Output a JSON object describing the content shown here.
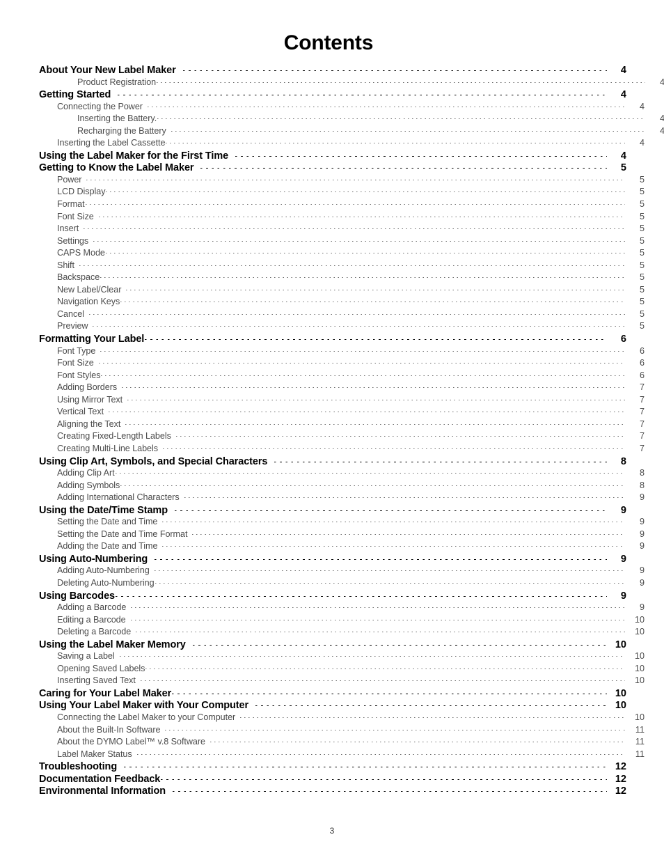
{
  "document": {
    "title": "Contents",
    "footer_page_number": "3"
  },
  "colors": {
    "heading_text": "#000000",
    "entry_text": "#4b4b4b",
    "leader_bold": "#000000",
    "leader_regular": "#6e6e6e",
    "background": "#ffffff"
  },
  "toc": {
    "entries": [
      {
        "label": "About Your New Label Maker",
        "page": "4",
        "level": 0,
        "tight": false
      },
      {
        "label": "Product Registration",
        "page": "4",
        "level": 2,
        "tight": true
      },
      {
        "label": "Getting Started",
        "page": "4",
        "level": 0,
        "tight": false
      },
      {
        "label": "Connecting the Power",
        "page": "4",
        "level": 1,
        "tight": false
      },
      {
        "label": "Inserting the Battery.",
        "page": "4",
        "level": 2,
        "tight": true
      },
      {
        "label": "Recharging the Battery",
        "page": "4",
        "level": 2,
        "tight": false
      },
      {
        "label": "Inserting the Label Cassette",
        "page": "4",
        "level": 1,
        "tight": true
      },
      {
        "label": "Using the Label Maker for the First Time",
        "page": "4",
        "level": 0,
        "tight": false
      },
      {
        "label": "Getting to Know the Label Maker",
        "page": "5",
        "level": 0,
        "tight": false
      },
      {
        "label": "Power",
        "page": "5",
        "level": 1,
        "tight": false
      },
      {
        "label": "LCD Display",
        "page": "5",
        "level": 1,
        "tight": true
      },
      {
        "label": "Format",
        "page": "5",
        "level": 1,
        "tight": true
      },
      {
        "label": "Font Size",
        "page": "5",
        "level": 1,
        "tight": false
      },
      {
        "label": "Insert",
        "page": "5",
        "level": 1,
        "tight": false
      },
      {
        "label": "Settings",
        "page": "5",
        "level": 1,
        "tight": false
      },
      {
        "label": "CAPS Mode",
        "page": "5",
        "level": 1,
        "tight": true
      },
      {
        "label": "Shift",
        "page": "5",
        "level": 1,
        "tight": false
      },
      {
        "label": "Backspace",
        "page": "5",
        "level": 1,
        "tight": true
      },
      {
        "label": "New Label/Clear",
        "page": "5",
        "level": 1,
        "tight": false
      },
      {
        "label": "Navigation Keys",
        "page": "5",
        "level": 1,
        "tight": true
      },
      {
        "label": "Cancel",
        "page": "5",
        "level": 1,
        "tight": false
      },
      {
        "label": "Preview",
        "page": "5",
        "level": 1,
        "tight": false
      },
      {
        "label": "Formatting Your Label",
        "page": "6",
        "level": 0,
        "tight": true
      },
      {
        "label": "Font Type",
        "page": "6",
        "level": 1,
        "tight": false
      },
      {
        "label": "Font Size",
        "page": "6",
        "level": 1,
        "tight": false
      },
      {
        "label": "Font Styles",
        "page": "6",
        "level": 1,
        "tight": true
      },
      {
        "label": "Adding Borders",
        "page": "7",
        "level": 1,
        "tight": false
      },
      {
        "label": "Using Mirror Text",
        "page": "7",
        "level": 1,
        "tight": false
      },
      {
        "label": "Vertical Text",
        "page": "7",
        "level": 1,
        "tight": false
      },
      {
        "label": "Aligning the Text",
        "page": "7",
        "level": 1,
        "tight": false
      },
      {
        "label": "Creating Fixed-Length Labels",
        "page": "7",
        "level": 1,
        "tight": false
      },
      {
        "label": "Creating Multi-Line Labels",
        "page": "7",
        "level": 1,
        "tight": false
      },
      {
        "label": "Using Clip Art, Symbols, and Special Characters",
        "page": "8",
        "level": 0,
        "tight": false
      },
      {
        "label": "Adding Clip Art",
        "page": "8",
        "level": 1,
        "tight": true
      },
      {
        "label": "Adding Symbols",
        "page": "8",
        "level": 1,
        "tight": true
      },
      {
        "label": "Adding International Characters",
        "page": "9",
        "level": 1,
        "tight": false
      },
      {
        "label": "Using the Date/Time Stamp",
        "page": "9",
        "level": 0,
        "tight": false
      },
      {
        "label": "Setting the Date and Time",
        "page": "9",
        "level": 1,
        "tight": false
      },
      {
        "label": "Setting the Date and Time Format",
        "page": "9",
        "level": 1,
        "tight": false
      },
      {
        "label": "Adding the Date and Time",
        "page": "9",
        "level": 1,
        "tight": false
      },
      {
        "label": "Using Auto-Numbering",
        "page": "9",
        "level": 0,
        "tight": false
      },
      {
        "label": "Adding Auto-Numbering",
        "page": "9",
        "level": 1,
        "tight": false
      },
      {
        "label": "Deleting Auto-Numbering",
        "page": "9",
        "level": 1,
        "tight": true
      },
      {
        "label": "Using Barcodes",
        "page": "9",
        "level": 0,
        "tight": true
      },
      {
        "label": "Adding a Barcode",
        "page": "9",
        "level": 1,
        "tight": false
      },
      {
        "label": "Editing a Barcode",
        "page": "10",
        "level": 1,
        "tight": false
      },
      {
        "label": "Deleting a Barcode",
        "page": "10",
        "level": 1,
        "tight": false
      },
      {
        "label": "Using the Label Maker Memory",
        "page": "10",
        "level": 0,
        "tight": false
      },
      {
        "label": "Saving a Label",
        "page": "10",
        "level": 1,
        "tight": false
      },
      {
        "label": "Opening Saved Labels",
        "page": "10",
        "level": 1,
        "tight": true
      },
      {
        "label": "Inserting Saved Text",
        "page": "10",
        "level": 1,
        "tight": false
      },
      {
        "label": "Caring for Your Label Maker",
        "page": "10",
        "level": 0,
        "tight": true
      },
      {
        "label": "Using Your Label Maker with Your Computer",
        "page": "10",
        "level": 0,
        "tight": false
      },
      {
        "label": "Connecting the Label Maker to your Computer",
        "page": "10",
        "level": 1,
        "tight": false
      },
      {
        "label": "About the Built-In Software",
        "page": "11",
        "level": 1,
        "tight": false
      },
      {
        "label": "About the DYMO Label™ v.8 Software",
        "page": "11",
        "level": 1,
        "tight": false
      },
      {
        "label": "Label Maker Status",
        "page": "11",
        "level": 1,
        "tight": false
      },
      {
        "label": "Troubleshooting",
        "page": "12",
        "level": 0,
        "tight": false
      },
      {
        "label": "Documentation Feedback",
        "page": "12",
        "level": 0,
        "tight": true
      },
      {
        "label": "Environmental Information",
        "page": "12",
        "level": 0,
        "tight": false
      }
    ]
  }
}
